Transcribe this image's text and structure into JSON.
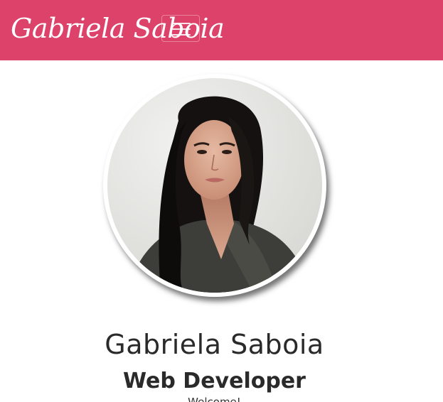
{
  "navbar": {
    "brand": "Gabriela Saboia",
    "background_color": "#dd426b",
    "toggler_icon": "hamburger-menu-icon"
  },
  "profile": {
    "photo": "profile-photo",
    "name": "Gabriela Saboia",
    "title": "Web Developer",
    "greeting": "Welcome!"
  }
}
